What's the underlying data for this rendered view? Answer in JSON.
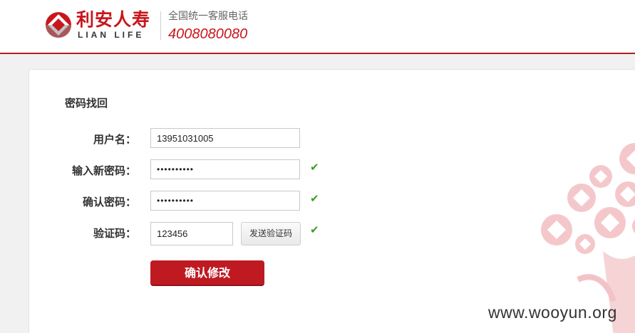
{
  "header": {
    "brand_cn": "利安人寿",
    "brand_en": "LIAN LIFE",
    "hotline_label": "全国统一客服电话",
    "hotline_number": "4008080080"
  },
  "form": {
    "title": "密码找回",
    "username": {
      "label": "用户名：",
      "value": "13951031005"
    },
    "new_password": {
      "label": "输入新密码：",
      "value": "••••••••••",
      "valid": true
    },
    "confirm_password": {
      "label": "确认密码：",
      "value": "••••••••••",
      "valid": true
    },
    "verify_code": {
      "label": "验证码：",
      "value": "123456",
      "valid": true
    },
    "send_code_label": "发送验证码",
    "submit_label": "确认修改"
  },
  "watermark": "www.wooyun.org",
  "colors": {
    "brand_red": "#c8161d",
    "check_green": "#3f9a2a"
  }
}
